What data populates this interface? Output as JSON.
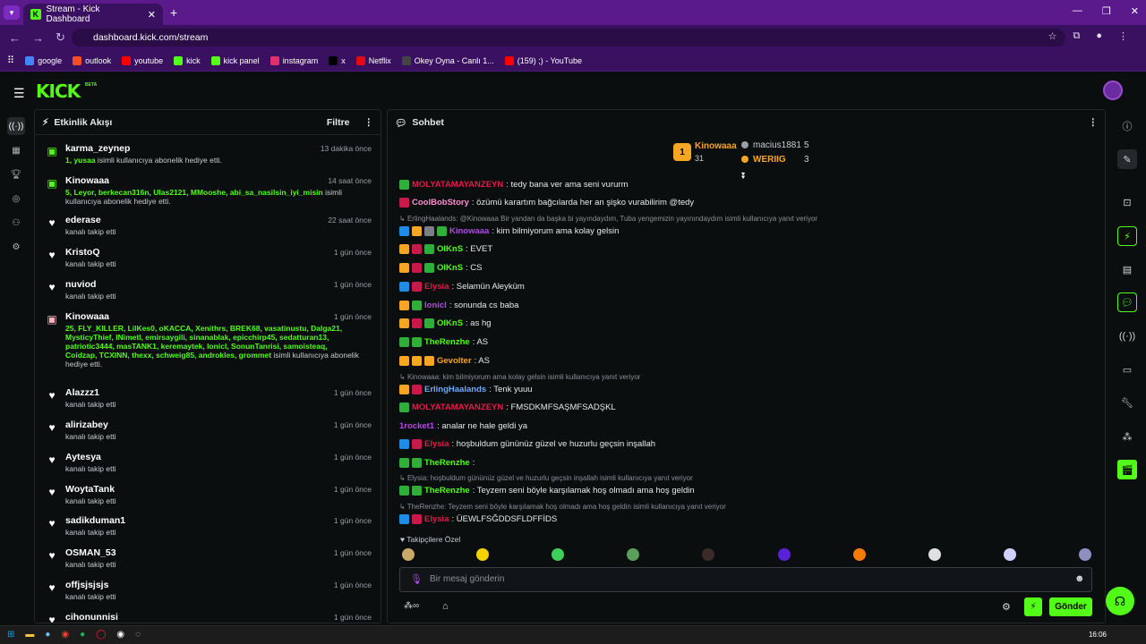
{
  "browser": {
    "tab_title": "Stream - Kick Dashboard",
    "url": "dashboard.kick.com/stream",
    "bookmarks": [
      {
        "label": "google",
        "color": "#4285f4"
      },
      {
        "label": "outlook",
        "color": "#f25022"
      },
      {
        "label": "youtube",
        "color": "#ff0000"
      },
      {
        "label": "kick",
        "color": "#53fc18"
      },
      {
        "label": "kick panel",
        "color": "#53fc18"
      },
      {
        "label": "instagram",
        "color": "#e1306c"
      },
      {
        "label": "x",
        "color": "#000000"
      },
      {
        "label": "Netflix",
        "color": "#e50914"
      },
      {
        "label": "Okey Oyna - Canlı 1...",
        "color": "#444444"
      },
      {
        "label": "(159) ;) - YouTube",
        "color": "#ff0000"
      }
    ]
  },
  "app": {
    "logo": "KICK",
    "beta": "BETA"
  },
  "activity": {
    "title": "Etkinlik Akışı",
    "filter": "Filtre",
    "events": [
      {
        "name": "karma_zeynep",
        "time": "13 dakika önce",
        "highlight": "1, yusaa",
        "desc": " isimli kullanıcıya abonelik hediye etti.",
        "icon": "gift"
      },
      {
        "name": "Kinowaaa",
        "time": "14 saat önce",
        "highlight": "5, Leyor, berkecan316n, Ulas2121, MMooshe, abi_sa_nasilsin_iyi_misin",
        "desc": " isimli kullanıcıya abonelik hediye etti.",
        "icon": "gift"
      },
      {
        "name": "ederase",
        "time": "22 saat önce",
        "highlight": "",
        "desc": "kanalı takip etti",
        "icon": "heart"
      },
      {
        "name": "KristoQ",
        "time": "1 gün önce",
        "highlight": "",
        "desc": "kanalı takip etti",
        "icon": "heart"
      },
      {
        "name": "nuviod",
        "time": "1 gün önce",
        "highlight": "",
        "desc": "kanalı takip etti",
        "icon": "heart"
      },
      {
        "name": "Kinowaaa",
        "time": "1 gün önce",
        "highlight": "25, FLY_KILLER, LilKes0, oKACCA, Xenithrs, BREK68, vasatinustu, Dalga21, MysticyThief, INimetl, emirsaygili, sinanablak, epicchirp45, sedatturan13, patriotic3444, masTANK1, keremaytek, lonicl, SonunTanrisi, samoisteaq, Coidzap, TCXINN, thexx, schweig85, androkles, grommet",
        "desc": " isimli kullanıcıya abonelik hediye etti.",
        "icon": "gift2"
      },
      {
        "name": "Alazzz1",
        "time": "1 gün önce",
        "highlight": "",
        "desc": "kanalı takip etti",
        "icon": "heart"
      },
      {
        "name": "alirizabey",
        "time": "1 gün önce",
        "highlight": "",
        "desc": "kanalı takip etti",
        "icon": "heart"
      },
      {
        "name": "Aytesya",
        "time": "1 gün önce",
        "highlight": "",
        "desc": "kanalı takip etti",
        "icon": "heart"
      },
      {
        "name": "WoytaTank",
        "time": "1 gün önce",
        "highlight": "",
        "desc": "kanalı takip etti",
        "icon": "heart"
      },
      {
        "name": "sadikduman1",
        "time": "1 gün önce",
        "highlight": "",
        "desc": "kanalı takip etti",
        "icon": "heart"
      },
      {
        "name": "OSMAN_53",
        "time": "1 gün önce",
        "highlight": "",
        "desc": "kanalı takip etti",
        "icon": "heart"
      },
      {
        "name": "offjsjsjsjs",
        "time": "1 gün önce",
        "highlight": "",
        "desc": "kanalı takip etti",
        "icon": "heart"
      },
      {
        "name": "cihonunnisi",
        "time": "1 gün önce",
        "highlight": "",
        "desc": "",
        "icon": "heart"
      }
    ]
  },
  "chat": {
    "title": "Sohbet",
    "placeholder": "Bir mesaj gönderin",
    "send": "Gönder",
    "followers_only": "Takipçilere Özel",
    "leaderboard": {
      "first_name": "Kinowaaa",
      "first_count": "31",
      "second_name": "macius1881",
      "second_count": "5",
      "third_name": "WERIIG",
      "third_count": "3"
    },
    "messages": [
      {
        "kind": "msg",
        "user": "MOLYATAMAYANZEYN",
        "color": "#e6194b",
        "text": ": tedy bana ver ama seni vururm",
        "badges": [
          "gr"
        ]
      },
      {
        "kind": "msg",
        "user": "CoolBobStory",
        "color": "#ff8fd0",
        "text": ": özümü karartım bağcılarda her an şişko vurabilirim @tedy",
        "badges": [
          "rd"
        ]
      },
      {
        "kind": "reply",
        "text": "ErlingHaalands: @Kinowaaa Bir yandan da başka bi yayındaydım, Tuba yengemizin yayınındaydım isimli kullanıcıya yanıt veriyor"
      },
      {
        "kind": "msg",
        "user": "Kinowaaa",
        "color": "#b14ae6",
        "text": ": kim bilmiyorum ama kolay gelsin",
        "badges": [
          "bl",
          "yl",
          "gy",
          "gr"
        ]
      },
      {
        "kind": "msg",
        "user": "OIKnS",
        "color": "#53fc18",
        "text": ": EVET",
        "badges": [
          "yl",
          "rd",
          "gr"
        ]
      },
      {
        "kind": "msg",
        "user": "OIKnS",
        "color": "#53fc18",
        "text": ": CS",
        "badges": [
          "yl",
          "rd",
          "gr"
        ]
      },
      {
        "kind": "msg",
        "user": "Elysia",
        "color": "#e6194b",
        "text": ": Selamün Aleyküm",
        "badges": [
          "bl",
          "rd"
        ]
      },
      {
        "kind": "msg",
        "user": "Ionicl",
        "color": "#b14ae6",
        "text": ": sonunda cs baba",
        "badges": [
          "yl",
          "gr"
        ]
      },
      {
        "kind": "msg",
        "user": "OIKnS",
        "color": "#53fc18",
        "text": ": as hg",
        "badges": [
          "yl",
          "rd",
          "gr"
        ]
      },
      {
        "kind": "msg",
        "user": "TheRenzhe",
        "color": "#53fc18",
        "text": ": AS",
        "badges": [
          "gr",
          "gr"
        ]
      },
      {
        "kind": "msg",
        "user": "Gevolter",
        "color": "#f5a623",
        "text": ": AS",
        "badges": [
          "yl",
          "yl",
          "yl"
        ]
      },
      {
        "kind": "reply",
        "text": "Kinowaaa: kim bilmiyorum ama kolay gelsin isimli kullanıcıya yanıt veriyor"
      },
      {
        "kind": "msg",
        "user": "ErlingHaalands",
        "color": "#6fa8ff",
        "text": ": Tenk yuuu",
        "badges": [
          "yl",
          "rd"
        ]
      },
      {
        "kind": "msg",
        "user": "MOLYATAMAYANZEYN",
        "color": "#e6194b",
        "text": ": FMSDKMFSAŞMFSADŞKL",
        "badges": [
          "gr"
        ]
      },
      {
        "kind": "msg",
        "user": "1rocket1",
        "color": "#b14ae6",
        "text": ": analar ne hale geldi ya",
        "badges": []
      },
      {
        "kind": "msg",
        "user": "Elysia",
        "color": "#e6194b",
        "text": ": hoşbuldum gününüz güzel ve huzurlu geçsin inşallah",
        "badges": [
          "bl",
          "rd"
        ]
      },
      {
        "kind": "msg",
        "user": "TheRenzhe",
        "color": "#53fc18",
        "text": ":",
        "badges": [
          "gr",
          "gr"
        ]
      },
      {
        "kind": "reply",
        "text": "Elysia: hoşbuldum gününüz güzel ve huzurlu geçsin inşallah  isimli kullanıcıya yanıt veriyor"
      },
      {
        "kind": "msg",
        "user": "TheRenzhe",
        "color": "#53fc18",
        "text": ": Teyzem seni böyle karşılamak hoş olmadı ama hoş geldin",
        "badges": [
          "gr",
          "gr"
        ]
      },
      {
        "kind": "reply",
        "text": "TheRenzhe: Teyzem seni böyle karşılamak hoş olmadı ama hoş geldin isimli kullanıcıya yanıt veriyor"
      },
      {
        "kind": "msg",
        "user": "Elysia",
        "color": "#e6194b",
        "text": ": ÜEWLFSĞDDSFLDFFİDS",
        "badges": [
          "bl",
          "rd"
        ]
      }
    ]
  },
  "system": {
    "clock": "16:06"
  }
}
